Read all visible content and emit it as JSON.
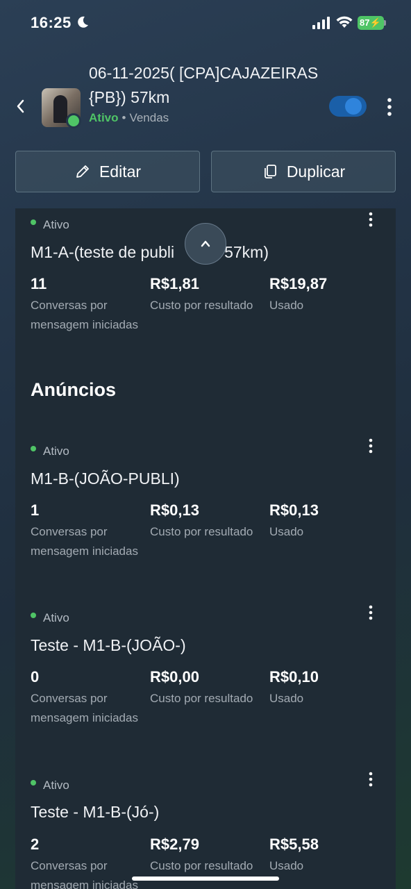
{
  "status_bar": {
    "time": "16:25",
    "battery": "87"
  },
  "header": {
    "title": "06-11-2025( [CPA]CAJAZEIRAS{PB}) 57km",
    "status": "Ativo",
    "separator": "•",
    "type": "Vendas",
    "toggle_on": true
  },
  "actions": {
    "edit_label": "Editar",
    "duplicate_label": "Duplicar"
  },
  "ad_set": {
    "status": "Ativo",
    "name": "M1-A-(teste de publi",
    "name_tail": "57km)",
    "metrics": [
      {
        "value": "11",
        "label": "Conversas por mensagem iniciadas"
      },
      {
        "value": "R$1,81",
        "label": "Custo por resultado"
      },
      {
        "value": "R$19,87",
        "label": "Usado"
      }
    ]
  },
  "ads_section_title": "Anúncios",
  "ads": [
    {
      "status": "Ativo",
      "name": "M1-B-(JOÃO-PUBLI)",
      "metrics": [
        {
          "value": "1",
          "label": "Conversas por mensagem iniciadas"
        },
        {
          "value": "R$0,13",
          "label": "Custo por resultado"
        },
        {
          "value": "R$0,13",
          "label": "Usado"
        }
      ]
    },
    {
      "status": "Ativo",
      "name": "Teste - M1-B-(JOÃO-)",
      "metrics": [
        {
          "value": "0",
          "label": "Conversas por mensagem iniciadas"
        },
        {
          "value": "R$0,00",
          "label": "Custo por resultado"
        },
        {
          "value": "R$0,10",
          "label": "Usado"
        }
      ]
    },
    {
      "status": "Ativo",
      "name": "Teste - M1-B-(Jó-)",
      "metrics": [
        {
          "value": "2",
          "label": "Conversas por mensagem iniciadas"
        },
        {
          "value": "R$2,79",
          "label": "Custo por resultado"
        },
        {
          "value": "R$5,58",
          "label": "Usado"
        }
      ]
    }
  ],
  "colors": {
    "active_green": "#4fc466",
    "toggle_blue": "#1a5fa8"
  }
}
